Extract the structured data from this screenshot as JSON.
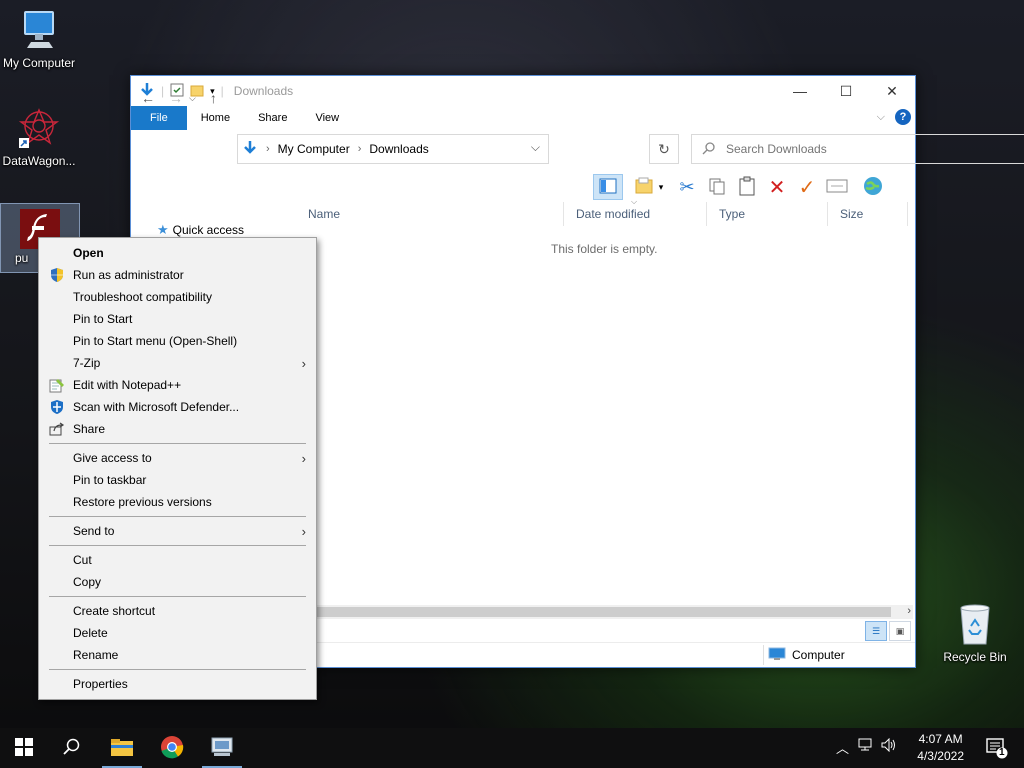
{
  "desktop": {
    "icons": [
      {
        "label": "My Computer",
        "icon": "monitor-icon"
      },
      {
        "label": "DataWagon...",
        "icon": "datawagon-icon"
      },
      {
        "label": "pu",
        "icon": "flash-icon"
      },
      {
        "label": "Recycle Bin",
        "icon": "recycle-bin-icon"
      }
    ]
  },
  "explorer": {
    "title": "Downloads",
    "ribbon_tabs": [
      "File",
      "Home",
      "Share",
      "View"
    ],
    "breadcrumb": [
      "My Computer",
      "Downloads"
    ],
    "search_placeholder": "Search Downloads",
    "nav_pane": {
      "quick_access": "Quick access"
    },
    "columns": [
      "Name",
      "Date modified",
      "Type",
      "Size"
    ],
    "empty_message": "This folder is empty.",
    "status_location": "Computer"
  },
  "context_menu": {
    "items": [
      {
        "label": "Open",
        "bold": true
      },
      {
        "label": "Run as administrator",
        "icon": "shield-icon"
      },
      {
        "label": "Troubleshoot compatibility"
      },
      {
        "label": "Pin to Start"
      },
      {
        "label": "Pin to Start menu (Open-Shell)"
      },
      {
        "label": "7-Zip",
        "submenu": true
      },
      {
        "label": "Edit with Notepad++",
        "icon": "notepadpp-icon"
      },
      {
        "label": "Scan with Microsoft Defender...",
        "icon": "defender-icon"
      },
      {
        "label": "Share",
        "icon": "share-icon"
      },
      {
        "label": "Give access to",
        "submenu": true
      },
      {
        "label": "Pin to taskbar"
      },
      {
        "label": "Restore previous versions"
      },
      {
        "label": "Send to",
        "submenu": true
      },
      {
        "label": "Cut"
      },
      {
        "label": "Copy"
      },
      {
        "label": "Create shortcut"
      },
      {
        "label": "Delete"
      },
      {
        "label": "Rename"
      },
      {
        "label": "Properties"
      }
    ]
  },
  "taskbar": {
    "time": "4:07 AM",
    "date": "4/3/2022",
    "notification_count": "1",
    "pinned": [
      "start-icon",
      "search-icon",
      "file-explorer-icon",
      "chrome-icon",
      "control-panel-icon"
    ]
  }
}
